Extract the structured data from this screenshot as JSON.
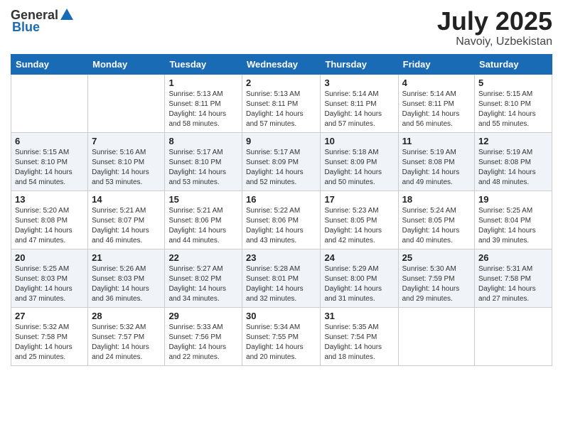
{
  "header": {
    "logo_general": "General",
    "logo_blue": "Blue",
    "month_year": "July 2025",
    "location": "Navoiy, Uzbekistan"
  },
  "days_of_week": [
    "Sunday",
    "Monday",
    "Tuesday",
    "Wednesday",
    "Thursday",
    "Friday",
    "Saturday"
  ],
  "weeks": [
    [
      {
        "day": "",
        "sunrise": "",
        "sunset": "",
        "daylight": ""
      },
      {
        "day": "",
        "sunrise": "",
        "sunset": "",
        "daylight": ""
      },
      {
        "day": "1",
        "sunrise": "Sunrise: 5:13 AM",
        "sunset": "Sunset: 8:11 PM",
        "daylight": "Daylight: 14 hours and 58 minutes."
      },
      {
        "day": "2",
        "sunrise": "Sunrise: 5:13 AM",
        "sunset": "Sunset: 8:11 PM",
        "daylight": "Daylight: 14 hours and 57 minutes."
      },
      {
        "day": "3",
        "sunrise": "Sunrise: 5:14 AM",
        "sunset": "Sunset: 8:11 PM",
        "daylight": "Daylight: 14 hours and 57 minutes."
      },
      {
        "day": "4",
        "sunrise": "Sunrise: 5:14 AM",
        "sunset": "Sunset: 8:11 PM",
        "daylight": "Daylight: 14 hours and 56 minutes."
      },
      {
        "day": "5",
        "sunrise": "Sunrise: 5:15 AM",
        "sunset": "Sunset: 8:10 PM",
        "daylight": "Daylight: 14 hours and 55 minutes."
      }
    ],
    [
      {
        "day": "6",
        "sunrise": "Sunrise: 5:15 AM",
        "sunset": "Sunset: 8:10 PM",
        "daylight": "Daylight: 14 hours and 54 minutes."
      },
      {
        "day": "7",
        "sunrise": "Sunrise: 5:16 AM",
        "sunset": "Sunset: 8:10 PM",
        "daylight": "Daylight: 14 hours and 53 minutes."
      },
      {
        "day": "8",
        "sunrise": "Sunrise: 5:17 AM",
        "sunset": "Sunset: 8:10 PM",
        "daylight": "Daylight: 14 hours and 53 minutes."
      },
      {
        "day": "9",
        "sunrise": "Sunrise: 5:17 AM",
        "sunset": "Sunset: 8:09 PM",
        "daylight": "Daylight: 14 hours and 52 minutes."
      },
      {
        "day": "10",
        "sunrise": "Sunrise: 5:18 AM",
        "sunset": "Sunset: 8:09 PM",
        "daylight": "Daylight: 14 hours and 50 minutes."
      },
      {
        "day": "11",
        "sunrise": "Sunrise: 5:19 AM",
        "sunset": "Sunset: 8:08 PM",
        "daylight": "Daylight: 14 hours and 49 minutes."
      },
      {
        "day": "12",
        "sunrise": "Sunrise: 5:19 AM",
        "sunset": "Sunset: 8:08 PM",
        "daylight": "Daylight: 14 hours and 48 minutes."
      }
    ],
    [
      {
        "day": "13",
        "sunrise": "Sunrise: 5:20 AM",
        "sunset": "Sunset: 8:08 PM",
        "daylight": "Daylight: 14 hours and 47 minutes."
      },
      {
        "day": "14",
        "sunrise": "Sunrise: 5:21 AM",
        "sunset": "Sunset: 8:07 PM",
        "daylight": "Daylight: 14 hours and 46 minutes."
      },
      {
        "day": "15",
        "sunrise": "Sunrise: 5:21 AM",
        "sunset": "Sunset: 8:06 PM",
        "daylight": "Daylight: 14 hours and 44 minutes."
      },
      {
        "day": "16",
        "sunrise": "Sunrise: 5:22 AM",
        "sunset": "Sunset: 8:06 PM",
        "daylight": "Daylight: 14 hours and 43 minutes."
      },
      {
        "day": "17",
        "sunrise": "Sunrise: 5:23 AM",
        "sunset": "Sunset: 8:05 PM",
        "daylight": "Daylight: 14 hours and 42 minutes."
      },
      {
        "day": "18",
        "sunrise": "Sunrise: 5:24 AM",
        "sunset": "Sunset: 8:05 PM",
        "daylight": "Daylight: 14 hours and 40 minutes."
      },
      {
        "day": "19",
        "sunrise": "Sunrise: 5:25 AM",
        "sunset": "Sunset: 8:04 PM",
        "daylight": "Daylight: 14 hours and 39 minutes."
      }
    ],
    [
      {
        "day": "20",
        "sunrise": "Sunrise: 5:25 AM",
        "sunset": "Sunset: 8:03 PM",
        "daylight": "Daylight: 14 hours and 37 minutes."
      },
      {
        "day": "21",
        "sunrise": "Sunrise: 5:26 AM",
        "sunset": "Sunset: 8:03 PM",
        "daylight": "Daylight: 14 hours and 36 minutes."
      },
      {
        "day": "22",
        "sunrise": "Sunrise: 5:27 AM",
        "sunset": "Sunset: 8:02 PM",
        "daylight": "Daylight: 14 hours and 34 minutes."
      },
      {
        "day": "23",
        "sunrise": "Sunrise: 5:28 AM",
        "sunset": "Sunset: 8:01 PM",
        "daylight": "Daylight: 14 hours and 32 minutes."
      },
      {
        "day": "24",
        "sunrise": "Sunrise: 5:29 AM",
        "sunset": "Sunset: 8:00 PM",
        "daylight": "Daylight: 14 hours and 31 minutes."
      },
      {
        "day": "25",
        "sunrise": "Sunrise: 5:30 AM",
        "sunset": "Sunset: 7:59 PM",
        "daylight": "Daylight: 14 hours and 29 minutes."
      },
      {
        "day": "26",
        "sunrise": "Sunrise: 5:31 AM",
        "sunset": "Sunset: 7:58 PM",
        "daylight": "Daylight: 14 hours and 27 minutes."
      }
    ],
    [
      {
        "day": "27",
        "sunrise": "Sunrise: 5:32 AM",
        "sunset": "Sunset: 7:58 PM",
        "daylight": "Daylight: 14 hours and 25 minutes."
      },
      {
        "day": "28",
        "sunrise": "Sunrise: 5:32 AM",
        "sunset": "Sunset: 7:57 PM",
        "daylight": "Daylight: 14 hours and 24 minutes."
      },
      {
        "day": "29",
        "sunrise": "Sunrise: 5:33 AM",
        "sunset": "Sunset: 7:56 PM",
        "daylight": "Daylight: 14 hours and 22 minutes."
      },
      {
        "day": "30",
        "sunrise": "Sunrise: 5:34 AM",
        "sunset": "Sunset: 7:55 PM",
        "daylight": "Daylight: 14 hours and 20 minutes."
      },
      {
        "day": "31",
        "sunrise": "Sunrise: 5:35 AM",
        "sunset": "Sunset: 7:54 PM",
        "daylight": "Daylight: 14 hours and 18 minutes."
      },
      {
        "day": "",
        "sunrise": "",
        "sunset": "",
        "daylight": ""
      },
      {
        "day": "",
        "sunrise": "",
        "sunset": "",
        "daylight": ""
      }
    ]
  ]
}
